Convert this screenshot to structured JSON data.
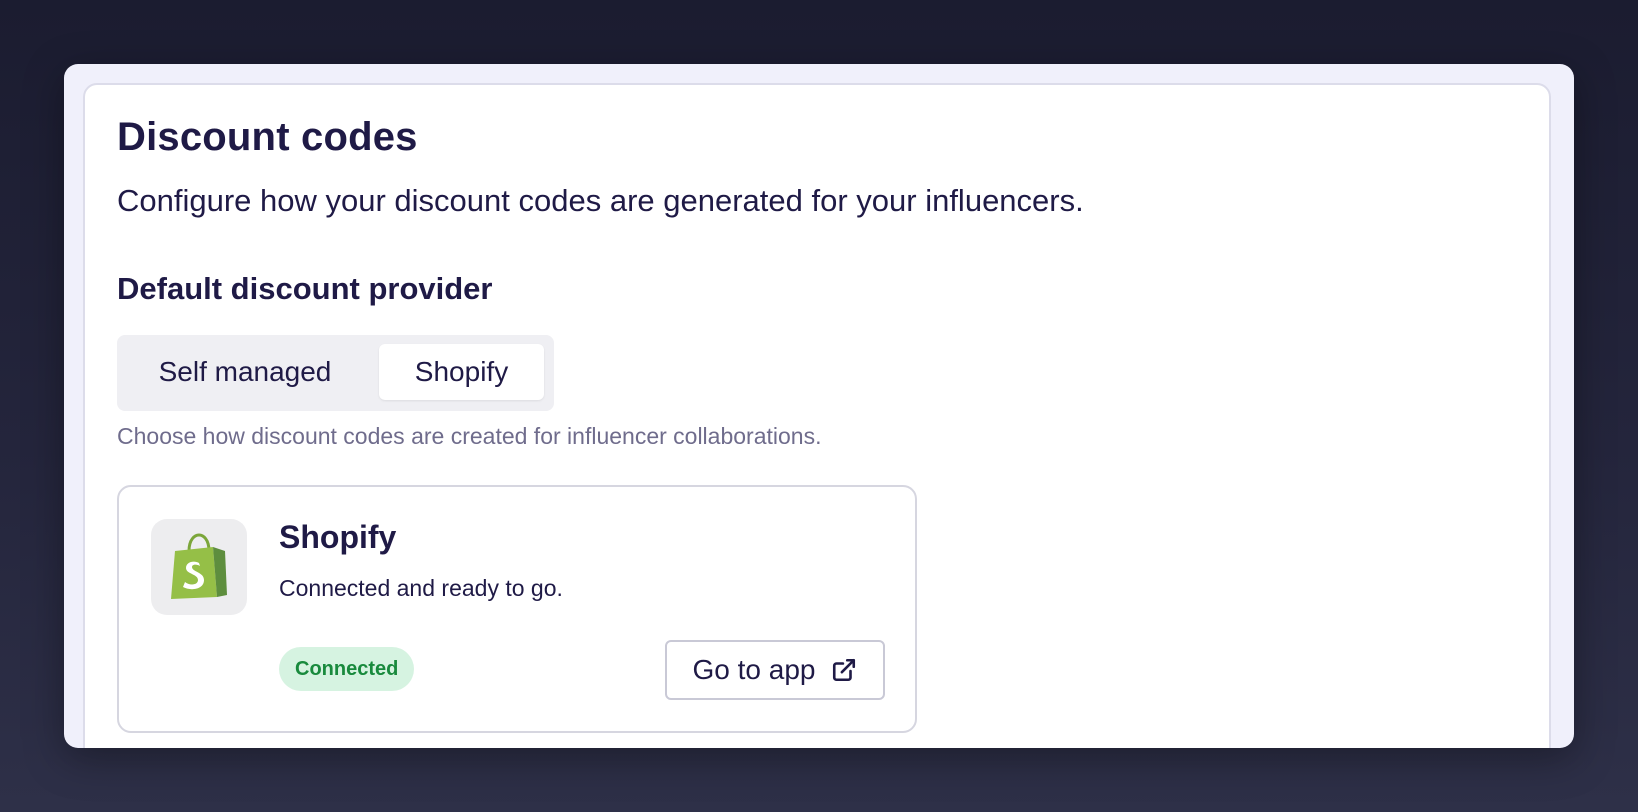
{
  "page": {
    "title": "Discount codes",
    "subtitle": "Configure how your discount codes are generated for your influencers."
  },
  "provider": {
    "section_title": "Default discount provider",
    "options": [
      "Self managed",
      "Shopify"
    ],
    "selected": "Shopify",
    "helper": "Choose how discount codes are created for influencer collaborations."
  },
  "integration_card": {
    "logo_icon": "shopify-bag-icon",
    "title": "Shopify",
    "description": "Connected and ready to go.",
    "status_badge": "Connected",
    "status_color": "#198a3d",
    "status_bg": "#d6f3e1",
    "action_label": "Go to app",
    "action_icon": "external-link-icon"
  },
  "colors": {
    "text_primary": "#1f1a46",
    "text_muted": "#6f6c8c",
    "shopify_green": "#95bf47"
  }
}
